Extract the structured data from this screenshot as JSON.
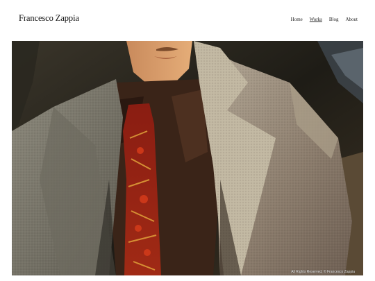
{
  "site": {
    "title": "Francesco Zappia"
  },
  "nav": {
    "items": [
      {
        "label": "Home",
        "active": false
      },
      {
        "label": "Works",
        "active": true
      },
      {
        "label": "Blog",
        "active": false
      },
      {
        "label": "About",
        "active": false
      }
    ]
  },
  "hero": {
    "copyright": "All Rights Reserved, © Francesco Zappia"
  },
  "colors": {
    "background": "#ffffff",
    "text": "#111111"
  }
}
